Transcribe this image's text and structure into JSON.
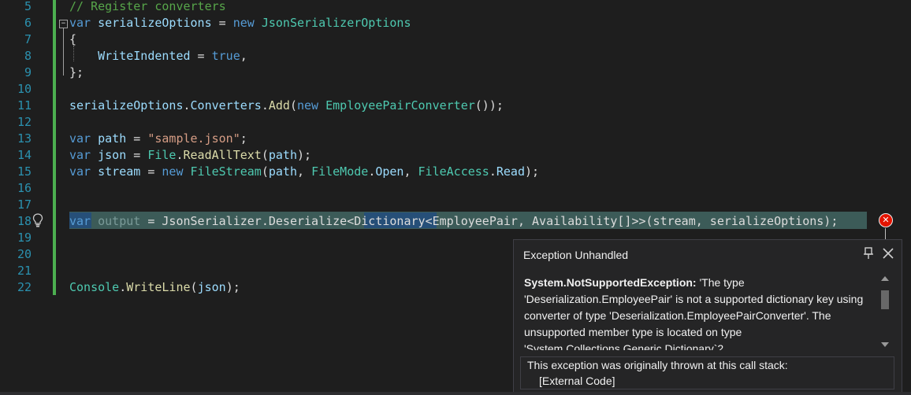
{
  "editor": {
    "line_numbers": [
      "5",
      "6",
      "7",
      "8",
      "9",
      "10",
      "11",
      "12",
      "13",
      "14",
      "15",
      "16",
      "17",
      "18",
      "19",
      "20",
      "21",
      "22"
    ],
    "lines": {
      "l5_comment": "// Register converters",
      "l6_var": "var",
      "l6_name": "serializeOptions",
      "l6_eq": " = ",
      "l6_new": "new",
      "l6_type": "JsonSerializerOptions",
      "l7": "{",
      "l8_prop": "WriteIndented",
      "l8_eq": " = ",
      "l8_true": "true",
      "l8_comma": ",",
      "l9": "};",
      "l11_obj": "serializeOptions",
      "l11_dot1": ".",
      "l11_prop": "Converters",
      "l11_dot2": ".",
      "l11_fn": "Add",
      "l11_open": "(",
      "l11_new": "new",
      "l11_type": "EmployeePairConverter",
      "l11_close": "());",
      "l13_var": "var",
      "l13_name": "path",
      "l13_eq": " = ",
      "l13_str": "\"sample.json\"",
      "l13_end": ";",
      "l14_var": "var",
      "l14_name": "json",
      "l14_eq": " = ",
      "l14_type": "File",
      "l14_dot": ".",
      "l14_fn": "ReadAllText",
      "l14_open": "(",
      "l14_arg": "path",
      "l14_end": ");",
      "l15_var": "var",
      "l15_name": "stream",
      "l15_eq": " = ",
      "l15_new": "new",
      "l15_type": "FileStream",
      "l15_open": "(",
      "l15_arg1": "path",
      "l15_c1": ", ",
      "l15_t2": "FileMode",
      "l15_d2": ".",
      "l15_m2": "Open",
      "l15_c2": ", ",
      "l15_t3": "FileAccess",
      "l15_d3": ".",
      "l15_m3": "Read",
      "l15_end": ");",
      "l18_var": "var",
      "l18_name": " output",
      "l18_rest": " = JsonSerializer.Deserialize<",
      "l18_dict": "Dictionary",
      "l18_tail": "<EmployeePair, Availability[]>>(stream, serializeOptions);",
      "l22_type": "Console",
      "l22_dot": ".",
      "l22_fn": "WriteLine",
      "l22_open": "(",
      "l22_arg": "json",
      "l22_end": ");"
    }
  },
  "exception_popup": {
    "title": "Exception Unhandled",
    "exception_type": "System.NotSupportedException:",
    "message": " 'The type 'Deserialization.EmployeePair' is not a supported dictionary key using converter of type 'Deserialization.EmployeePairConverter'. The unsupported member type is located on type 'System.Collections.Generic.Dictionary`2",
    "stack_title": "This exception was originally thrown at this call stack:",
    "stack_item": "[External Code]"
  },
  "colors": {
    "background": "#1e1e1e",
    "keyword": "#569cd6",
    "type": "#4ec9b0",
    "string": "#d69d85",
    "comment": "#57a64a",
    "line_number": "#2b91af",
    "error": "#e51400",
    "change_bar": "#4caf50"
  },
  "icons": {
    "lightbulb": "lightbulb-icon",
    "error": "error-x-icon",
    "pin": "pin-icon",
    "close": "close-icon"
  }
}
